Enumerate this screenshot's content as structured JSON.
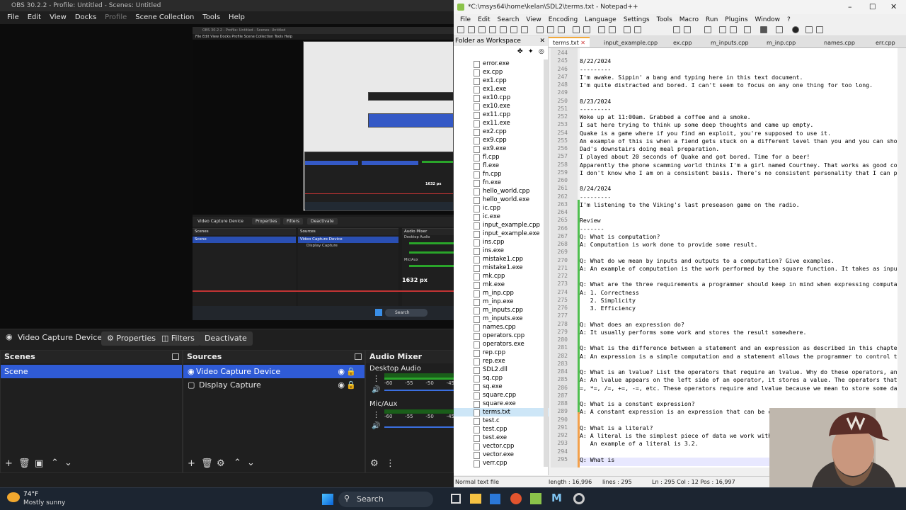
{
  "obs": {
    "title": "OBS 30.2.2 - Profile: Untitled - Scenes: Untitled",
    "menu": [
      "File",
      "Edit",
      "View",
      "Docks",
      "Profile",
      "Scene Collection",
      "Tools",
      "Help"
    ],
    "preview_nested": {
      "source_label": "Video Capture Device",
      "properties": "Properties",
      "filters": "Filters",
      "deactivate": "Deactivate",
      "scenes": "Scenes",
      "scene_item": "Scene",
      "sources": "Sources",
      "source1": "Video Capture Device",
      "source2": "Display Capture",
      "audio_mixer": "Audio Mixer",
      "desktop_audio": "Desktop Audio",
      "mic_aux": "Mic/Aux",
      "size_label": "1632 px",
      "search": "Search"
    },
    "source_bar": {
      "label": "Video Capture Device",
      "properties": "Properties",
      "filters": "Filters",
      "deactivate": "Deactivate"
    },
    "scenes": {
      "title": "Scenes",
      "items": [
        "Scene"
      ]
    },
    "sources": {
      "title": "Sources",
      "items": [
        "Video Capture Device",
        "Display Capture"
      ]
    },
    "audio_mixer": {
      "title": "Audio Mixer",
      "channels": [
        "Desktop Audio",
        "Mic/Aux"
      ],
      "ticks": [
        "-60",
        "-55",
        "-50",
        "-45"
      ]
    }
  },
  "notepad": {
    "title": "*C:\\msys64\\home\\kelan\\SDL2\\terms.txt - Notepad++",
    "menu": [
      "File",
      "Edit",
      "Search",
      "View",
      "Encoding",
      "Language",
      "Settings",
      "Tools",
      "Macro",
      "Run",
      "Plugins",
      "Window",
      "?"
    ],
    "panel_title": "Folder as Workspace",
    "tabs": [
      "terms.txt",
      "input_example.cpp",
      "ex.cpp",
      "m_inputs.cpp",
      "m_inp.cpp",
      "names.cpp",
      "err.cpp"
    ],
    "files": [
      "error.exe",
      "ex.cpp",
      "ex1.cpp",
      "ex1.exe",
      "ex10.cpp",
      "ex10.exe",
      "ex11.cpp",
      "ex11.exe",
      "ex2.cpp",
      "ex9.cpp",
      "ex9.exe",
      "fl.cpp",
      "fl.exe",
      "fn.cpp",
      "fn.exe",
      "hello_world.cpp",
      "hello_world.exe",
      "ic.cpp",
      "ic.exe",
      "input_example.cpp",
      "input_example.exe",
      "ins.cpp",
      "ins.exe",
      "mistake1.cpp",
      "mistake1.exe",
      "mk.cpp",
      "mk.exe",
      "m_inp.cpp",
      "m_inp.exe",
      "m_inputs.cpp",
      "m_inputs.exe",
      "names.cpp",
      "operators.cpp",
      "operators.exe",
      "rep.cpp",
      "rep.exe",
      "SDL2.dll",
      "sq.cpp",
      "sq.exe",
      "square.cpp",
      "square.exe",
      "terms.txt",
      "test.c",
      "test.cpp",
      "test.exe",
      "vector.cpp",
      "vector.exe",
      "verr.cpp"
    ],
    "lines": [
      {
        "n": "244",
        "t": ""
      },
      {
        "n": "245",
        "t": "8/22/2024"
      },
      {
        "n": "246",
        "t": "---------"
      },
      {
        "n": "247",
        "t": "I'm awake. Sippin' a bang and typing here in this text document."
      },
      {
        "n": "248",
        "t": "I'm quite distracted and bored. I can't seem to focus on any one thing for too long."
      },
      {
        "n": "249",
        "t": ""
      },
      {
        "n": "250",
        "t": "8/23/2024"
      },
      {
        "n": "251",
        "t": "---------"
      },
      {
        "n": "252",
        "t": "Woke up at 11:00am. Grabbed a coffee and a smoke."
      },
      {
        "n": "253",
        "t": "I sat here trying to think up some deep thoughts and came up empty."
      },
      {
        "n": "254",
        "t": "Quake is a game where if you find an exploit, you're supposed to use it."
      },
      {
        "n": "255",
        "t": "An example of this is when a fiend gets stuck on a different level than you and you can shoot"
      },
      {
        "n": "256",
        "t": "Dad's downstairs doing meal preparation."
      },
      {
        "n": "257",
        "t": "I played about 20 seconds of Quake and got bored. Time for a beer!"
      },
      {
        "n": "258",
        "t": "Apparently the phone scamming world thinks I'm a girl named Courtney. That works as good cove"
      },
      {
        "n": "259",
        "t": "I don't know who I am on a consistent basis. There's no consistent personality that I can poi"
      },
      {
        "n": "260",
        "t": ""
      },
      {
        "n": "261",
        "t": "8/24/2024"
      },
      {
        "n": "262",
        "t": "---------"
      },
      {
        "n": "263",
        "t": "I'm listening to the Viking's last preseason game on the radio."
      },
      {
        "n": "264",
        "t": ""
      },
      {
        "n": "265",
        "t": "Review"
      },
      {
        "n": "266",
        "t": "-------"
      },
      {
        "n": "267",
        "t": "Q: What is computation?"
      },
      {
        "n": "268",
        "t": "A: Computation is work done to provide some result."
      },
      {
        "n": "269",
        "t": ""
      },
      {
        "n": "270",
        "t": "Q: What do we mean by inputs and outputs to a computation? Give examples."
      },
      {
        "n": "271",
        "t": "A: An example of computation is the work performed by the square function. It takes as input"
      },
      {
        "n": "272",
        "t": ""
      },
      {
        "n": "273",
        "t": "Q: What are the three requirements a programmer should keep in mind when expressing computati"
      },
      {
        "n": "274",
        "t": "A: 1. Correctness"
      },
      {
        "n": "275",
        "t": "   2. Simplicity"
      },
      {
        "n": "276",
        "t": "   3. Efficiency"
      },
      {
        "n": "277",
        "t": ""
      },
      {
        "n": "278",
        "t": "Q: What does an expression do?"
      },
      {
        "n": "279",
        "t": "A: It usually performs some work and stores the result somewhere."
      },
      {
        "n": "280",
        "t": ""
      },
      {
        "n": "281",
        "t": "Q: What is the difference between a statement and an expression as described in this chapter"
      },
      {
        "n": "282",
        "t": "A: An expression is a simple computation and a statement allows the programmer to control the"
      },
      {
        "n": "283",
        "t": ""
      },
      {
        "n": "284",
        "t": "Q: What is an lvalue? List the operators that require an lvalue. Why do these operators, and"
      },
      {
        "n": "285",
        "t": "A: An lvalue appears on the left side of an operator, it stores a value. The operators that r"
      },
      {
        "n": "286",
        "t": "=, *=, /=, +=, -=, etc. These operators require and lvalue because we mean to store some data"
      },
      {
        "n": "287",
        "t": ""
      },
      {
        "n": "288",
        "t": "Q: What is a constant expression?"
      },
      {
        "n": "289",
        "t": "A: A constant expression is an expression that can be co"
      },
      {
        "n": "290",
        "t": ""
      },
      {
        "n": "291",
        "t": "Q: What is a literal?"
      },
      {
        "n": "292",
        "t": "A: A literal is the simplest piece of data we work with."
      },
      {
        "n": "293",
        "t": "   An example of a literal is 3.2."
      },
      {
        "n": "294",
        "t": ""
      },
      {
        "n": "295",
        "t": "Q: What is "
      }
    ],
    "status": {
      "type": "Normal text file",
      "length": "length : 16,996",
      "lines": "lines : 295",
      "pos": "Ln : 295   Col : 12   Pos : 16,997"
    }
  },
  "taskbar": {
    "weather_temp": "74°F",
    "weather_desc": "Mostly sunny",
    "search": "Search"
  }
}
